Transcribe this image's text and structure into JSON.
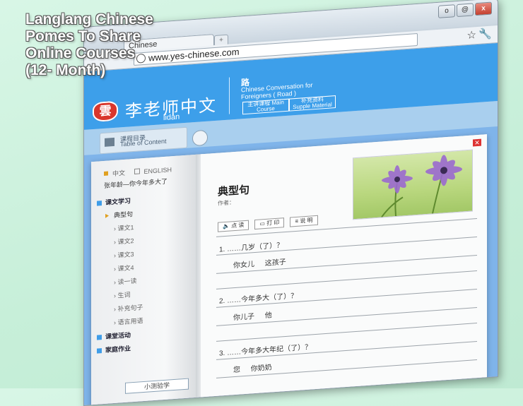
{
  "promo": {
    "lines": [
      "Langlang Chinese",
      "Pomes To Share",
      "Online Courses",
      "(12- Month)"
    ]
  },
  "browser": {
    "tab_title": "Chinese",
    "url": "www.yes-chinese.com",
    "win_buttons": [
      "o",
      "@",
      "x"
    ]
  },
  "site": {
    "logo_char": "雲",
    "brand_cn": "李老师中文",
    "brand_en": "lidan",
    "lesson_title_cn": "路",
    "lesson_title_en": "Chinese Conversation for Foreigners ( Road )",
    "btn_main_course": "主讲课程 Main Course",
    "btn_supplemental": "补充资料 Supple Material",
    "toc_cn": "课程目录",
    "toc_en": "Table of Content"
  },
  "sidebar": {
    "lang_cn": "中文",
    "lang_en": "ENGLISH",
    "lesson": "张年龄—你今年多大了",
    "items": [
      {
        "label": "课文学习",
        "kind": "sec"
      },
      {
        "label": "典型句",
        "kind": "cur"
      },
      {
        "label": "课文1",
        "kind": "sub"
      },
      {
        "label": "课文2",
        "kind": "sub"
      },
      {
        "label": "课文3",
        "kind": "sub"
      },
      {
        "label": "课文4",
        "kind": "sub"
      },
      {
        "label": "读一读",
        "kind": "sub"
      },
      {
        "label": "生词",
        "kind": "sub"
      },
      {
        "label": "补充句子",
        "kind": "sub"
      },
      {
        "label": "语言用语",
        "kind": "sub"
      },
      {
        "label": "课堂活动",
        "kind": "sec"
      },
      {
        "label": "家庭作业",
        "kind": "sec"
      }
    ],
    "test_button": "小测验学"
  },
  "main": {
    "title": "典型句",
    "author": "作者：",
    "tools": [
      "点 读",
      "打 印",
      "说 明"
    ],
    "questions": [
      {
        "q": "1.  ……几岁（了）？",
        "a": "你女儿  这孩子"
      },
      {
        "q": "2.  ……今年多大（了）？",
        "a": "你儿子  他"
      },
      {
        "q": "3.  ……今年多大年纪（了）？",
        "a": "您  你奶奶"
      }
    ]
  }
}
